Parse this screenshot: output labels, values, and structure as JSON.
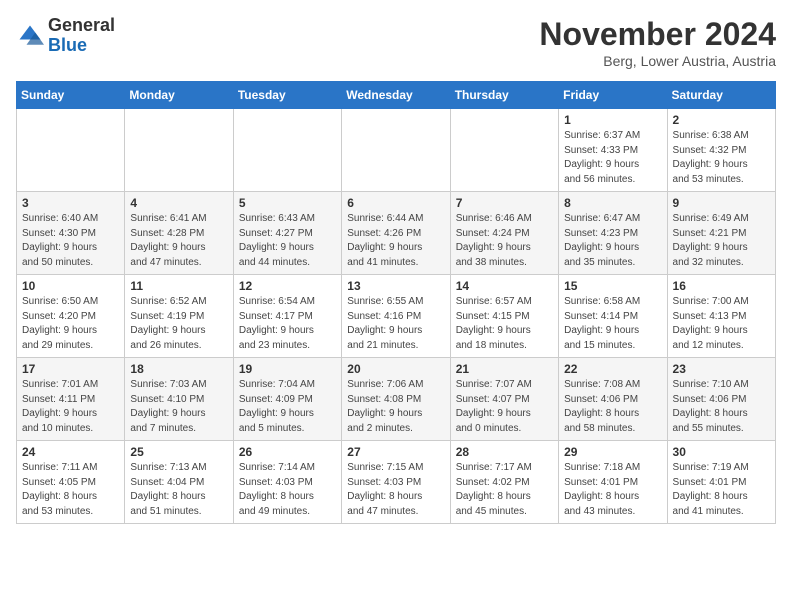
{
  "header": {
    "logo_general": "General",
    "logo_blue": "Blue",
    "month_title": "November 2024",
    "location": "Berg, Lower Austria, Austria"
  },
  "days_of_week": [
    "Sunday",
    "Monday",
    "Tuesday",
    "Wednesday",
    "Thursday",
    "Friday",
    "Saturday"
  ],
  "weeks": [
    [
      {
        "day": "",
        "info": ""
      },
      {
        "day": "",
        "info": ""
      },
      {
        "day": "",
        "info": ""
      },
      {
        "day": "",
        "info": ""
      },
      {
        "day": "",
        "info": ""
      },
      {
        "day": "1",
        "info": "Sunrise: 6:37 AM\nSunset: 4:33 PM\nDaylight: 9 hours\nand 56 minutes."
      },
      {
        "day": "2",
        "info": "Sunrise: 6:38 AM\nSunset: 4:32 PM\nDaylight: 9 hours\nand 53 minutes."
      }
    ],
    [
      {
        "day": "3",
        "info": "Sunrise: 6:40 AM\nSunset: 4:30 PM\nDaylight: 9 hours\nand 50 minutes."
      },
      {
        "day": "4",
        "info": "Sunrise: 6:41 AM\nSunset: 4:28 PM\nDaylight: 9 hours\nand 47 minutes."
      },
      {
        "day": "5",
        "info": "Sunrise: 6:43 AM\nSunset: 4:27 PM\nDaylight: 9 hours\nand 44 minutes."
      },
      {
        "day": "6",
        "info": "Sunrise: 6:44 AM\nSunset: 4:26 PM\nDaylight: 9 hours\nand 41 minutes."
      },
      {
        "day": "7",
        "info": "Sunrise: 6:46 AM\nSunset: 4:24 PM\nDaylight: 9 hours\nand 38 minutes."
      },
      {
        "day": "8",
        "info": "Sunrise: 6:47 AM\nSunset: 4:23 PM\nDaylight: 9 hours\nand 35 minutes."
      },
      {
        "day": "9",
        "info": "Sunrise: 6:49 AM\nSunset: 4:21 PM\nDaylight: 9 hours\nand 32 minutes."
      }
    ],
    [
      {
        "day": "10",
        "info": "Sunrise: 6:50 AM\nSunset: 4:20 PM\nDaylight: 9 hours\nand 29 minutes."
      },
      {
        "day": "11",
        "info": "Sunrise: 6:52 AM\nSunset: 4:19 PM\nDaylight: 9 hours\nand 26 minutes."
      },
      {
        "day": "12",
        "info": "Sunrise: 6:54 AM\nSunset: 4:17 PM\nDaylight: 9 hours\nand 23 minutes."
      },
      {
        "day": "13",
        "info": "Sunrise: 6:55 AM\nSunset: 4:16 PM\nDaylight: 9 hours\nand 21 minutes."
      },
      {
        "day": "14",
        "info": "Sunrise: 6:57 AM\nSunset: 4:15 PM\nDaylight: 9 hours\nand 18 minutes."
      },
      {
        "day": "15",
        "info": "Sunrise: 6:58 AM\nSunset: 4:14 PM\nDaylight: 9 hours\nand 15 minutes."
      },
      {
        "day": "16",
        "info": "Sunrise: 7:00 AM\nSunset: 4:13 PM\nDaylight: 9 hours\nand 12 minutes."
      }
    ],
    [
      {
        "day": "17",
        "info": "Sunrise: 7:01 AM\nSunset: 4:11 PM\nDaylight: 9 hours\nand 10 minutes."
      },
      {
        "day": "18",
        "info": "Sunrise: 7:03 AM\nSunset: 4:10 PM\nDaylight: 9 hours\nand 7 minutes."
      },
      {
        "day": "19",
        "info": "Sunrise: 7:04 AM\nSunset: 4:09 PM\nDaylight: 9 hours\nand 5 minutes."
      },
      {
        "day": "20",
        "info": "Sunrise: 7:06 AM\nSunset: 4:08 PM\nDaylight: 9 hours\nand 2 minutes."
      },
      {
        "day": "21",
        "info": "Sunrise: 7:07 AM\nSunset: 4:07 PM\nDaylight: 9 hours\nand 0 minutes."
      },
      {
        "day": "22",
        "info": "Sunrise: 7:08 AM\nSunset: 4:06 PM\nDaylight: 8 hours\nand 58 minutes."
      },
      {
        "day": "23",
        "info": "Sunrise: 7:10 AM\nSunset: 4:06 PM\nDaylight: 8 hours\nand 55 minutes."
      }
    ],
    [
      {
        "day": "24",
        "info": "Sunrise: 7:11 AM\nSunset: 4:05 PM\nDaylight: 8 hours\nand 53 minutes."
      },
      {
        "day": "25",
        "info": "Sunrise: 7:13 AM\nSunset: 4:04 PM\nDaylight: 8 hours\nand 51 minutes."
      },
      {
        "day": "26",
        "info": "Sunrise: 7:14 AM\nSunset: 4:03 PM\nDaylight: 8 hours\nand 49 minutes."
      },
      {
        "day": "27",
        "info": "Sunrise: 7:15 AM\nSunset: 4:03 PM\nDaylight: 8 hours\nand 47 minutes."
      },
      {
        "day": "28",
        "info": "Sunrise: 7:17 AM\nSunset: 4:02 PM\nDaylight: 8 hours\nand 45 minutes."
      },
      {
        "day": "29",
        "info": "Sunrise: 7:18 AM\nSunset: 4:01 PM\nDaylight: 8 hours\nand 43 minutes."
      },
      {
        "day": "30",
        "info": "Sunrise: 7:19 AM\nSunset: 4:01 PM\nDaylight: 8 hours\nand 41 minutes."
      }
    ]
  ]
}
